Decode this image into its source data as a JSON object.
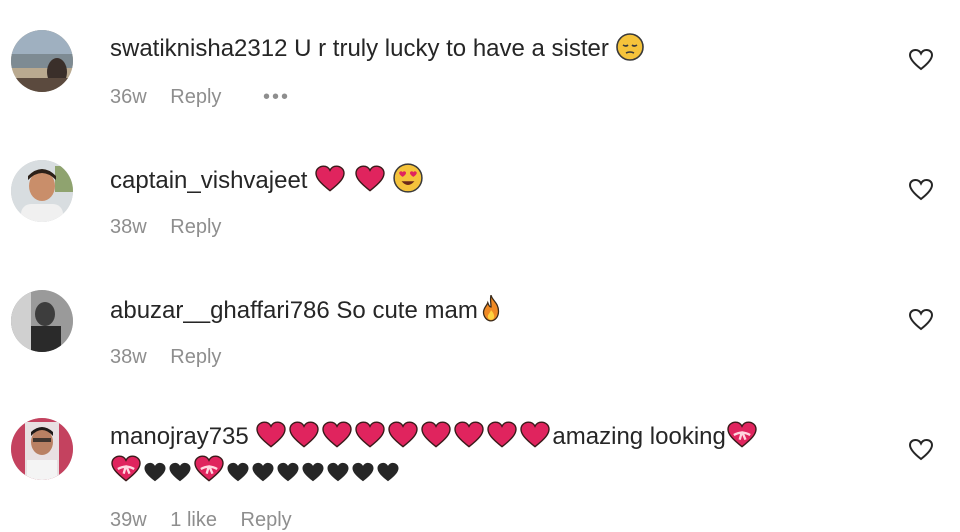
{
  "comments": [
    {
      "username": "swatiknisha2312",
      "text": "U r truly lucky to have a sister",
      "emojis": [
        "pensive-face"
      ],
      "time": "36w",
      "reply_label": "Reply",
      "likes": "",
      "more": "•••"
    },
    {
      "username": "captain_vishvajeet",
      "text": "",
      "emojis": [
        "red-heart",
        "red-heart",
        "heart-eyes-face"
      ],
      "time": "38w",
      "reply_label": "Reply",
      "likes": ""
    },
    {
      "username": "abuzar__ghaffari786",
      "text": "So cute mam",
      "emojis": [
        "fire"
      ],
      "time": "38w",
      "reply_label": "Reply",
      "likes": ""
    },
    {
      "username": "manojray735",
      "text": "amazing looking",
      "emojis_before_text": [
        "red-heart",
        "red-heart",
        "red-heart",
        "red-heart",
        "red-heart",
        "red-heart",
        "red-heart",
        "red-heart",
        "red-heart"
      ],
      "emojis_after_text": [
        "heart-with-ribbon"
      ],
      "emojis_line2": [
        "heart-with-ribbon",
        "black-heart",
        "black-heart",
        "heart-with-ribbon",
        "black-heart",
        "black-heart",
        "black-heart",
        "black-heart",
        "black-heart",
        "black-heart",
        "black-heart"
      ],
      "time": "39w",
      "likes": "1 like",
      "reply_label": "Reply"
    }
  ],
  "colors": {
    "text": "#262626",
    "meta": "#8e8e8e",
    "heart_red": "#e0245e",
    "black_heart": "#262626"
  }
}
